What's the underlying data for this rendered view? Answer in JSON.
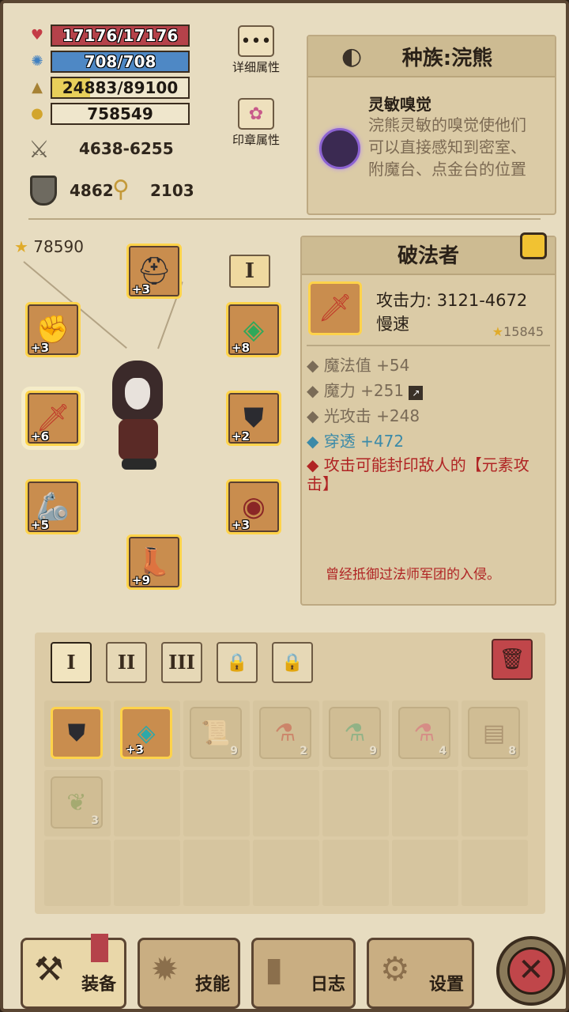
{
  "stats": {
    "hp": "17176/17176",
    "mp": "708/708",
    "xp": "24883/89100",
    "xp_fraction": 0.28,
    "gold": "758549",
    "attack": "4638-6255",
    "armor": "4862",
    "magic": "2103"
  },
  "buttons": {
    "detail_attrs": "详细属性",
    "seal_attrs": "印章属性"
  },
  "race": {
    "title": "种族:浣熊",
    "skill_name": "灵敏嗅觉",
    "skill_desc": "浣熊灵敏的嗅觉使他们可以直接感知到密室、附魔台、点金台的位置"
  },
  "character": {
    "power": "78590",
    "layer_badge": "I"
  },
  "equip_slots": [
    {
      "name": "helmet",
      "icon": "helmet-icon",
      "level": "+3"
    },
    {
      "name": "gloves",
      "icon": "gauntlet-icon",
      "level": "+3"
    },
    {
      "name": "amulet",
      "icon": "amulet-icon",
      "level": "+8"
    },
    {
      "name": "weapon",
      "icon": "sword-icon",
      "level": "+6"
    },
    {
      "name": "armor",
      "icon": "armor-icon",
      "level": "+2"
    },
    {
      "name": "bracer",
      "icon": "bracer-icon",
      "level": "+5"
    },
    {
      "name": "cloak",
      "icon": "cloak-icon",
      "level": "+3"
    },
    {
      "name": "boots",
      "icon": "boots-icon",
      "level": "+9"
    }
  ],
  "item_detail": {
    "name": "破法者",
    "attack": "攻击力: 3121-4672",
    "speed": "慢速",
    "score": "15845",
    "attrs": [
      "魔法值 +54",
      "魔力 +251",
      "光攻击 +248",
      "穿透 +472"
    ],
    "special": "攻击可能封印敌人的【元素攻击】",
    "flavor": "曾经抵御过法师军团的入侵。"
  },
  "inventory": {
    "tabs": [
      "I",
      "II",
      "III"
    ],
    "items": [
      {
        "icon": "armor-icon",
        "count": "",
        "level": "",
        "lit": true
      },
      {
        "icon": "amulet-icon",
        "count": "",
        "level": "+3",
        "lit": true
      },
      {
        "icon": "scroll-icon",
        "count": "9",
        "level": "",
        "lit": false
      },
      {
        "icon": "potion-red-icon",
        "count": "2",
        "level": "",
        "lit": false
      },
      {
        "icon": "potion-green-icon",
        "count": "9",
        "level": "",
        "lit": false
      },
      {
        "icon": "potion-pink-icon",
        "count": "4",
        "level": "",
        "lit": false
      },
      {
        "icon": "chest-icon",
        "count": "8",
        "level": "",
        "lit": false
      },
      {
        "icon": "herb-icon",
        "count": "3",
        "level": "",
        "lit": false
      }
    ]
  },
  "nav": {
    "equip": "装备",
    "skills": "技能",
    "log": "日志",
    "settings": "设置"
  }
}
